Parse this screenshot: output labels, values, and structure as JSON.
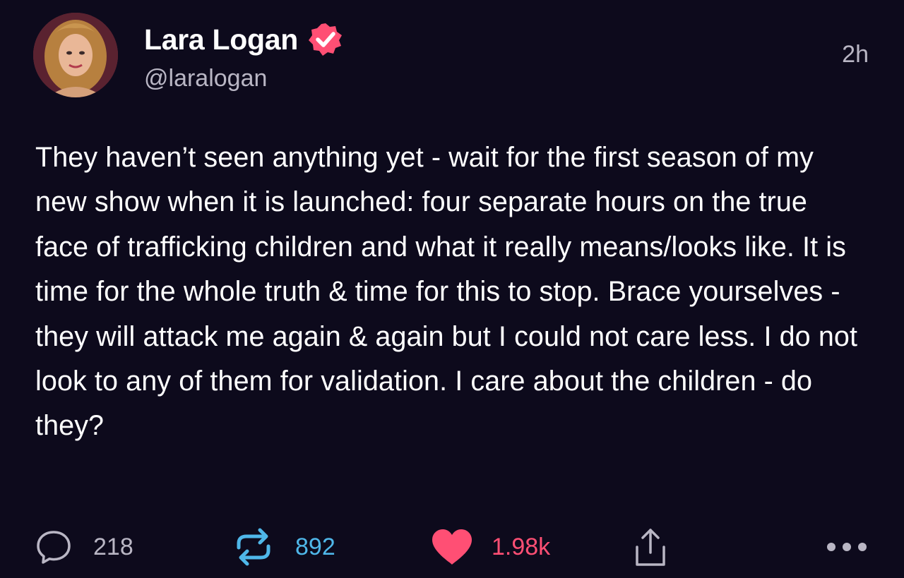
{
  "author": {
    "name": "Lara Logan",
    "handle": "@laralogan",
    "verified": true
  },
  "post": {
    "time": "2h",
    "text": "They haven’t seen anything yet - wait for the first season of my new show when it is launched: four separate hours on the true face of trafficking children and what it really means/looks like. It is time for the whole truth & time for this to stop. Brace yourselves - they will attack me again & again but I could not care less. I do not look to any of them for validation. I care about the children - do they?"
  },
  "actions": {
    "replies": "218",
    "reposts": "892",
    "likes": "1.98k"
  },
  "colors": {
    "background": "#0d0a1c",
    "verified_badge": "#ff4f74",
    "repost": "#4fb7e9",
    "like": "#ff4f74",
    "secondary_text": "#b9b6c4"
  },
  "icons": {
    "reply": "speech-bubble-icon",
    "repost": "repost-arrows-icon",
    "like": "heart-icon",
    "share": "share-upload-icon",
    "more": "more-dots-icon",
    "verified": "verified-badge-icon"
  }
}
